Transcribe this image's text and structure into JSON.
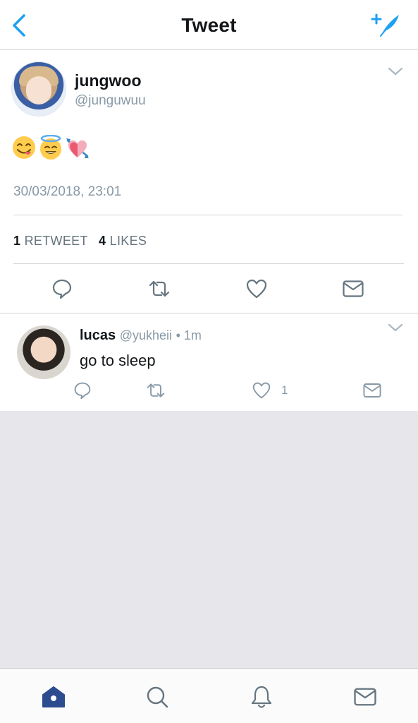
{
  "header": {
    "title": "Tweet",
    "back_icon": "chevron-left-icon",
    "compose_icon": "compose-feather-icon"
  },
  "tweet": {
    "author_name": "jungwoo",
    "author_handle": "@junguwuu",
    "emojis": [
      "yum-face",
      "smiling-face-with-halo",
      "heart-with-arrow"
    ],
    "timestamp": "30/03/2018, 23:01",
    "retweets_count": "1",
    "retweets_label": "RETWEET",
    "likes_count": "4",
    "likes_label": "LIKES",
    "actions": [
      "reply-icon",
      "retweet-icon",
      "like-icon",
      "dm-icon"
    ]
  },
  "reply": {
    "author_name": "lucas",
    "author_handle": "@yukheii",
    "time": "• 1m",
    "text": "go to sleep",
    "like_count": "1"
  },
  "tabbar": {
    "tabs": [
      "home-icon",
      "search-icon",
      "notifications-icon",
      "messages-icon"
    ]
  },
  "colors": {
    "accent": "#1da1f2",
    "tab_active": "#2d4b8f",
    "secondary_text": "#8899a6",
    "divider": "#d4d4d8",
    "empty_bg": "#e6e6eb"
  }
}
